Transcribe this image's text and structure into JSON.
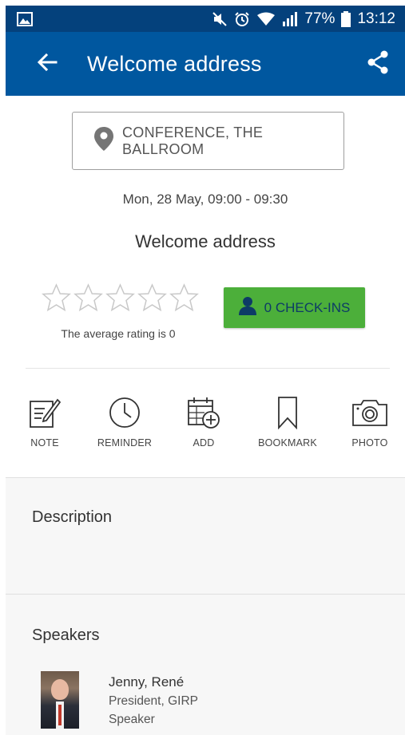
{
  "status_bar": {
    "battery_percent": "77%",
    "time": "13:12",
    "icons": [
      "image-icon",
      "mute-icon",
      "alarm-icon",
      "wifi-icon",
      "signal-icon",
      "battery-icon"
    ]
  },
  "app_bar": {
    "title": "Welcome address",
    "back_icon": "arrow-left-icon",
    "share_icon": "share-icon"
  },
  "location": {
    "icon": "map-pin-icon",
    "label": "CONFERENCE, THE BALLROOM"
  },
  "session": {
    "datetime": "Mon, 28 May, 09:00 - 09:30",
    "title": "Welcome address"
  },
  "rating": {
    "stars_filled": 0,
    "stars_total": 5,
    "average_text": "The average rating is 0"
  },
  "checkins": {
    "label": "0 CHECK-INS"
  },
  "actions": [
    {
      "label": "NOTE",
      "icon": "note-icon"
    },
    {
      "label": "REMINDER",
      "icon": "clock-icon"
    },
    {
      "label": "ADD",
      "icon": "calendar-add-icon"
    },
    {
      "label": "BOOKMARK",
      "icon": "bookmark-icon"
    },
    {
      "label": "PHOTO",
      "icon": "camera-icon"
    }
  ],
  "description": {
    "heading": "Description"
  },
  "speakers": {
    "heading": "Speakers",
    "items": [
      {
        "name": "Jenny, René",
        "role": "President, GIRP",
        "kind": "Speaker"
      }
    ]
  },
  "colors": {
    "status_bar": "#04417c",
    "app_bar": "#00579f",
    "checkin_button": "#4caf3a",
    "checkin_text": "#0d3b66"
  }
}
